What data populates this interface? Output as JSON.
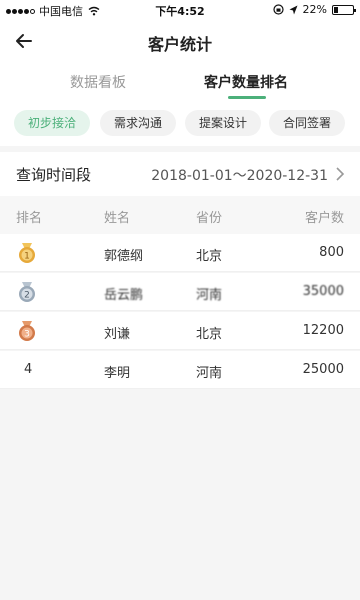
{
  "status_bar": {
    "carrier": "中国电信",
    "time": "下午4:52",
    "battery": "22%",
    "battery_level": 0.22
  },
  "nav": {
    "title": "客户统计"
  },
  "tabs": [
    {
      "label": "数据看板",
      "active": false
    },
    {
      "label": "客户数量排名",
      "active": true
    }
  ],
  "chips": [
    {
      "label": "初步接洽",
      "active": true
    },
    {
      "label": "需求沟通",
      "active": false
    },
    {
      "label": "提案设计",
      "active": false
    },
    {
      "label": "合同签署",
      "active": false
    }
  ],
  "query": {
    "label": "查询时间段",
    "range": "2018-01-01～2020-12-31"
  },
  "table": {
    "headers": {
      "rank": "排名",
      "name": "姓名",
      "province": "省份",
      "count": "客户数"
    },
    "rows": [
      {
        "rank": "1",
        "medal": "gold",
        "name": "郭德纲",
        "province": "北京",
        "count": "800"
      },
      {
        "rank": "2",
        "medal": "silver",
        "name": "岳云鹏",
        "province": "河南",
        "count": "35000"
      },
      {
        "rank": "3",
        "medal": "bronze",
        "name": "刘谦",
        "province": "北京",
        "count": "12200"
      },
      {
        "rank": "4",
        "medal": "",
        "name": "李明",
        "province": "河南",
        "count": "25000"
      }
    ]
  },
  "colors": {
    "accent": "#4cb07a",
    "gold": "#e6a93a",
    "silver": "#9aa9b8",
    "bronze": "#d27a4a"
  },
  "icons": {
    "back": "arrow-left-icon",
    "chevron": "chevron-right-icon"
  }
}
